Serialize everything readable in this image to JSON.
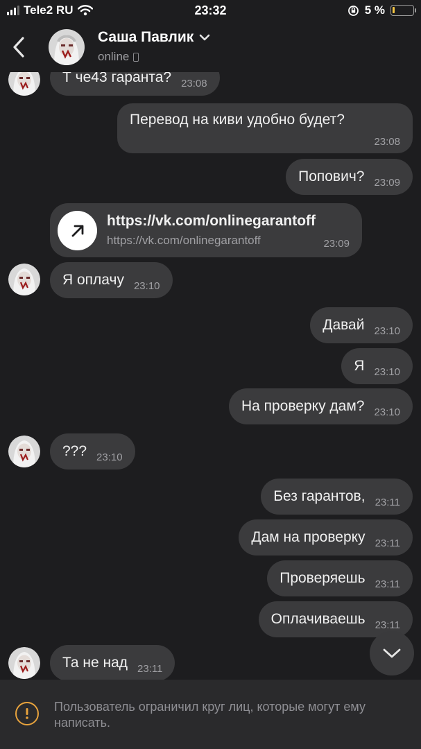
{
  "status_bar": {
    "carrier": "Tele2 RU",
    "time": "23:32",
    "battery": "5 %"
  },
  "header": {
    "contact_name": "Саша Павлик",
    "status": "online"
  },
  "messages": [
    {
      "text": "Т че43 гаранта?",
      "time": "23:08"
    },
    {
      "text": "Перевод на киви удобно будет?",
      "time": "23:08"
    },
    {
      "text": "Попович?",
      "time": "23:09"
    },
    {
      "text": "Я оплачу",
      "time": "23:10"
    },
    {
      "text": "Давай",
      "time": "23:10"
    },
    {
      "text": "Я",
      "time": "23:10"
    },
    {
      "text": "На проверку дам?",
      "time": "23:10"
    },
    {
      "text": "???",
      "time": "23:10"
    },
    {
      "text": "Без гарантов,",
      "time": "23:11"
    },
    {
      "text": "Дам на проверку",
      "time": "23:11"
    },
    {
      "text": "Проверяешь",
      "time": "23:11"
    },
    {
      "text": "Оплачиваешь",
      "time": "23:11"
    },
    {
      "text": "Та не над",
      "time": "23:11"
    }
  ],
  "link_message": {
    "title": "https://vk.com/onlinegarantoff",
    "url": "https://vk.com/onlinegarantoff",
    "time": "23:09"
  },
  "notice": {
    "text": "Пользователь ограничил круг лиц, которые могут ему написать."
  },
  "icons": {
    "back": "chevron-left-icon",
    "dropdown": "chevron-down-icon",
    "device": "phone-icon",
    "link": "arrow-up-right-icon",
    "scroll": "chevron-down-icon",
    "warning": "exclamation-circle-icon"
  },
  "colors": {
    "background": "#1d1d1f",
    "bubble": "#3b3b3d",
    "warning": "#e8a33d"
  }
}
